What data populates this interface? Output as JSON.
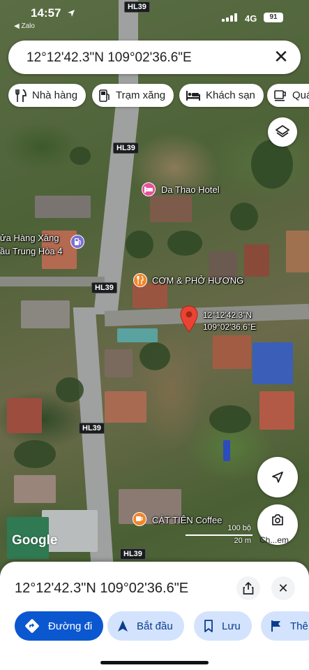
{
  "status_bar": {
    "time": "14:57",
    "back_app": "◀ Zalo",
    "network": "4G",
    "battery": "91"
  },
  "search": {
    "query": "12°12'42.3\"N 109°02'36.6\"E",
    "close_glyph": "✕"
  },
  "chips": [
    {
      "label": "Nhà hàng",
      "icon": "restaurant-icon"
    },
    {
      "label": "Trạm xăng",
      "icon": "gas-station-icon"
    },
    {
      "label": "Khách sạn",
      "icon": "hotel-icon"
    },
    {
      "label": "Quá",
      "icon": "cafe-icon"
    }
  ],
  "map": {
    "places": {
      "hotel": "Da Thao Hotel",
      "gas_station": "ửa Hàng Xăng\nầu Trung Hòa 4",
      "restaurant": "CƠM & PHỞ HƯƠNG",
      "coffee": "CÁT TIÊN Coffee"
    },
    "road_signs": [
      "HL39",
      "HL39",
      "HL39",
      "HL39",
      "HL39"
    ],
    "pin": {
      "lat": "12°12'42.3\"N",
      "lng": "109°02'36.6\"E"
    },
    "logo": "Google",
    "scale": {
      "feet": "100 bộ",
      "meters": "20 m"
    },
    "lens_label": "Ch...em"
  },
  "sheet": {
    "coords": "12°12'42.3\"N 109°02'36.6\"E",
    "close_glyph": "✕",
    "actions": [
      {
        "label": "Đường đi",
        "icon": "directions-icon"
      },
      {
        "label": "Bắt đầu",
        "icon": "navigation-start-icon"
      },
      {
        "label": "Lưu",
        "icon": "bookmark-icon"
      },
      {
        "label": "Thê",
        "icon": "flag-icon"
      }
    ]
  },
  "colors": {
    "primary": "#0b57d0",
    "secondary": "#d3e3fd",
    "pin": "#ea4335",
    "hotel": "#e8519b",
    "restaurant": "#f0862a",
    "gas": "#7b6fd6"
  }
}
